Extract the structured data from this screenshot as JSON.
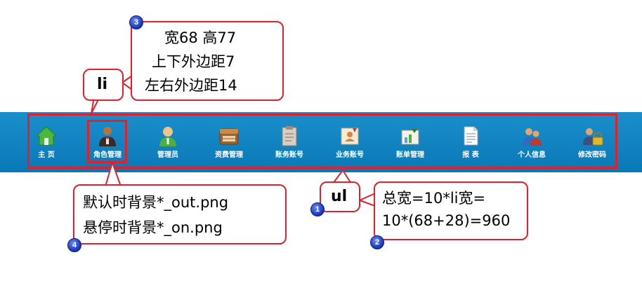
{
  "nav": {
    "items": [
      {
        "label": "主  页",
        "icon": "home-icon"
      },
      {
        "label": "角色管理",
        "icon": "role-person-icon"
      },
      {
        "label": "管理员",
        "icon": "admin-person-icon"
      },
      {
        "label": "资费管理",
        "icon": "fee-box-icon"
      },
      {
        "label": "账务账号",
        "icon": "account-doc-icon"
      },
      {
        "label": "业务账号",
        "icon": "business-card-icon"
      },
      {
        "label": "账单管理",
        "icon": "bill-chart-icon"
      },
      {
        "label": "报  表",
        "icon": "report-doc-icon"
      },
      {
        "label": "个人信息",
        "icon": "users-icon"
      },
      {
        "label": "修改密码",
        "icon": "lock-user-icon"
      }
    ],
    "colors": {
      "bar": "#1184c2",
      "highlight": "#e0202a",
      "label": "#ffffff"
    }
  },
  "annotations": {
    "li_label": "li",
    "li_specs": [
      "宽68 高77",
      "上下外边距7",
      "左右外边距14"
    ],
    "ul_label": "ul",
    "ul_specs": [
      "总宽=10*li宽=",
      "10*(68+28)=960"
    ],
    "bg_specs": [
      "默认时背景*_out.png",
      "悬停时背景*_on.png"
    ],
    "badges": [
      "1",
      "2",
      "3",
      "4"
    ]
  }
}
